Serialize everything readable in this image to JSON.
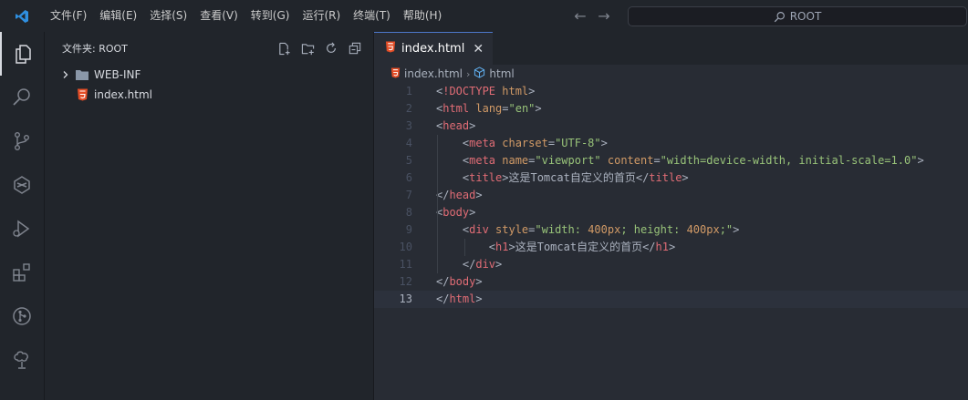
{
  "menu": [
    "文件(F)",
    "编辑(E)",
    "选择(S)",
    "查看(V)",
    "转到(G)",
    "运行(R)",
    "终端(T)",
    "帮助(H)"
  ],
  "search": {
    "text": "ROOT"
  },
  "activity": [
    "explorer-icon",
    "search-icon",
    "source-control-icon",
    "extensions-alt-icon",
    "run-debug-icon",
    "extensions-icon",
    "git-graph-icon",
    "remote-icon"
  ],
  "explorer": {
    "title": "文件夹: ROOT",
    "items": [
      {
        "label": "WEB-INF",
        "kind": "folder"
      },
      {
        "label": "index.html",
        "kind": "html-file"
      }
    ]
  },
  "tab": {
    "label": "index.html",
    "close": "✕"
  },
  "breadcrumb": {
    "file": "index.html",
    "symbol": "html"
  },
  "colors": {
    "accent": "#4d78cc",
    "html_icon": "#e44d26"
  },
  "code": {
    "current_line": 13,
    "lines": [
      [
        [
          "<",
          "t-punc"
        ],
        [
          "!DOCTYPE",
          "t-tag"
        ],
        [
          " html",
          "t-attr"
        ],
        [
          ">",
          "t-punc"
        ]
      ],
      [
        [
          "<",
          "t-punc"
        ],
        [
          "html",
          "t-tag"
        ],
        [
          " lang",
          "t-attr"
        ],
        [
          "=",
          "t-punc"
        ],
        [
          "\"en\"",
          "t-str"
        ],
        [
          ">",
          "t-punc"
        ]
      ],
      [
        [
          "<",
          "t-punc"
        ],
        [
          "head",
          "t-tag"
        ],
        [
          ">",
          "t-punc"
        ]
      ],
      [
        [
          "    <",
          "t-punc"
        ],
        [
          "meta",
          "t-tag"
        ],
        [
          " charset",
          "t-attr"
        ],
        [
          "=",
          "t-punc"
        ],
        [
          "\"UTF-8\"",
          "t-str"
        ],
        [
          ">",
          "t-punc"
        ]
      ],
      [
        [
          "    <",
          "t-punc"
        ],
        [
          "meta",
          "t-tag"
        ],
        [
          " name",
          "t-attr"
        ],
        [
          "=",
          "t-punc"
        ],
        [
          "\"viewport\"",
          "t-str"
        ],
        [
          " content",
          "t-attr"
        ],
        [
          "=",
          "t-punc"
        ],
        [
          "\"width=device-width, initial-scale=1.0\"",
          "t-str"
        ],
        [
          ">",
          "t-punc"
        ]
      ],
      [
        [
          "    <",
          "t-punc"
        ],
        [
          "title",
          "t-tag"
        ],
        [
          ">",
          "t-punc"
        ],
        [
          "这是Tomcat自定义的首页",
          "t-text"
        ],
        [
          "</",
          "t-punc"
        ],
        [
          "title",
          "t-tag"
        ],
        [
          ">",
          "t-punc"
        ]
      ],
      [
        [
          "</",
          "t-punc"
        ],
        [
          "head",
          "t-tag"
        ],
        [
          ">",
          "t-punc"
        ]
      ],
      [
        [
          "<",
          "t-punc"
        ],
        [
          "body",
          "t-tag"
        ],
        [
          ">",
          "t-punc"
        ]
      ],
      [
        [
          "    <",
          "t-punc"
        ],
        [
          "div",
          "t-tag"
        ],
        [
          " style",
          "t-attr"
        ],
        [
          "=",
          "t-punc"
        ],
        [
          "\"width: ",
          "t-str"
        ],
        [
          "400px",
          "t-attr"
        ],
        [
          "; height: ",
          "t-str"
        ],
        [
          "400px",
          "t-attr"
        ],
        [
          ";\"",
          "t-str"
        ],
        [
          ">",
          "t-punc"
        ]
      ],
      [
        [
          "        <",
          "t-punc"
        ],
        [
          "h1",
          "t-tag"
        ],
        [
          ">",
          "t-punc"
        ],
        [
          "这是Tomcat自定义的首页",
          "t-text"
        ],
        [
          "</",
          "t-punc"
        ],
        [
          "h1",
          "t-tag"
        ],
        [
          ">",
          "t-punc"
        ]
      ],
      [
        [
          "    </",
          "t-punc"
        ],
        [
          "div",
          "t-tag"
        ],
        [
          ">",
          "t-punc"
        ]
      ],
      [
        [
          "</",
          "t-punc"
        ],
        [
          "body",
          "t-tag"
        ],
        [
          ">",
          "t-punc"
        ]
      ],
      [
        [
          "</",
          "t-punc"
        ],
        [
          "html",
          "t-tag"
        ],
        [
          ">",
          "t-punc"
        ]
      ]
    ]
  }
}
